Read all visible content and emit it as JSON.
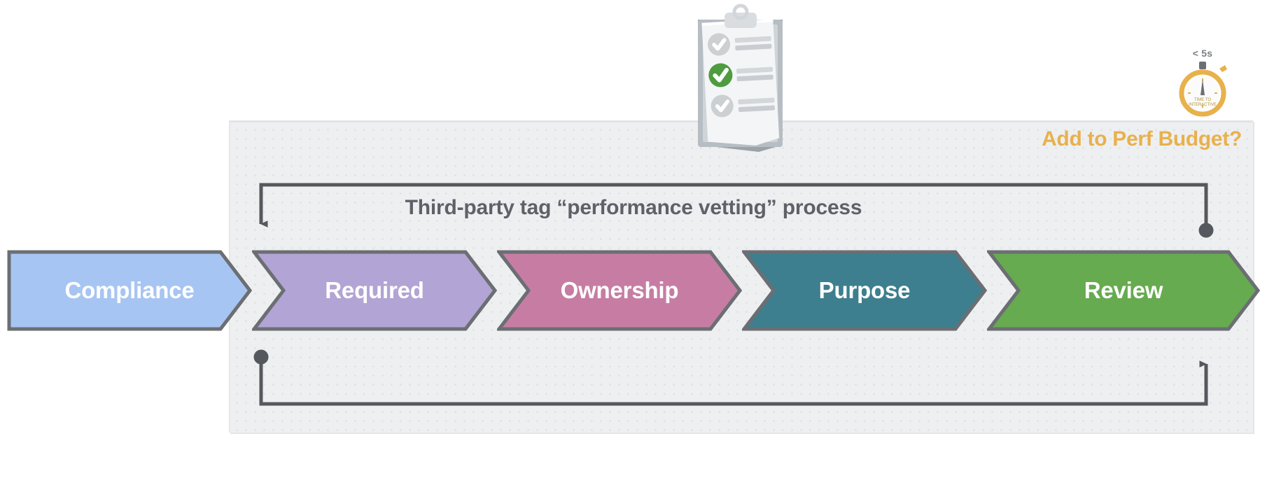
{
  "diagram": {
    "title": "Third-party tag “performance vetting” process",
    "panel_note": "Add to Perf Budget?",
    "accent_color": "#e8b14c",
    "title_color": "#5e6168",
    "connector_color": "#55585d",
    "panel_background": "#eeeff1"
  },
  "stages": [
    {
      "label": "Compliance",
      "color": "#a7c5f2",
      "border": "#6b6e73"
    },
    {
      "label": "Required",
      "color": "#b2a4d4",
      "border": "#6b6e73"
    },
    {
      "label": "Ownership",
      "color": "#c77da3",
      "border": "#6b6e73"
    },
    {
      "label": "Purpose",
      "color": "#3d7f8e",
      "border": "#6b6e73"
    },
    {
      "label": "Review",
      "color": "#66ab4f",
      "border": "#6b6e73"
    }
  ],
  "stopwatch": {
    "threshold": "< 5s",
    "dial_line_1": "TIME TO",
    "dial_line_2": "INTERACTIVE",
    "color": "#e8b14c"
  },
  "clipboard": {
    "icon": "clipboard-checklist-icon",
    "items": [
      {
        "state": "unchecked",
        "check_color": "#c9cbce"
      },
      {
        "state": "checked",
        "check_color": "#4e9c3f"
      },
      {
        "state": "unchecked",
        "check_color": "#c9cbce"
      }
    ]
  },
  "connectors": {
    "top_loop": {
      "start": "dot",
      "end": "arrow-down"
    },
    "bottom_loop": {
      "start": "dot",
      "end": "arrow-up"
    }
  }
}
